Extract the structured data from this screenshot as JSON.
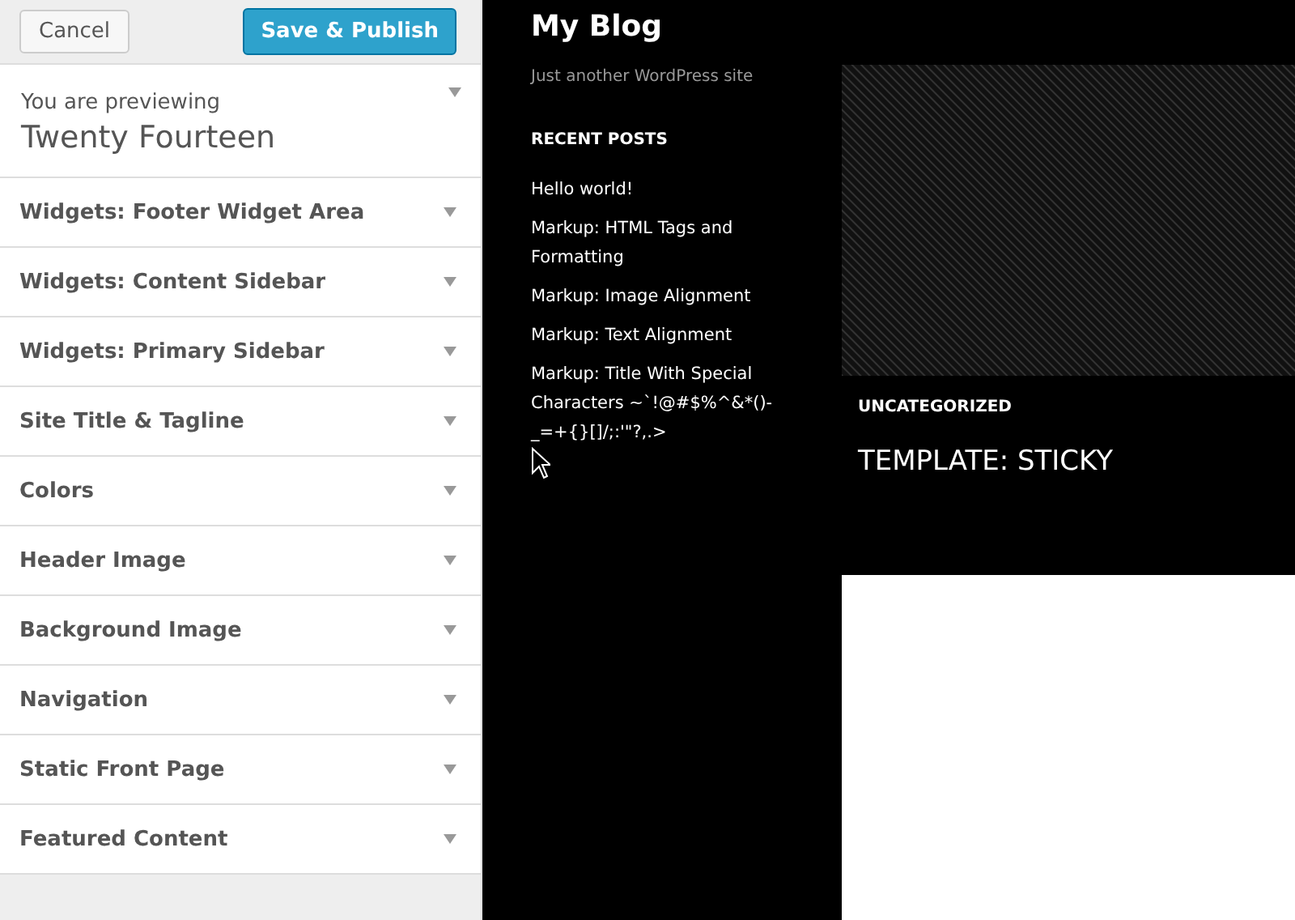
{
  "toolbar": {
    "cancel": "Cancel",
    "publish": "Save & Publish"
  },
  "theme_info": {
    "label": "You are previewing",
    "name": "Twenty Fourteen"
  },
  "sections": [
    {
      "label": "Widgets: Footer Widget Area"
    },
    {
      "label": "Widgets: Content Sidebar"
    },
    {
      "label": "Widgets: Primary Sidebar"
    },
    {
      "label": "Site Title & Tagline"
    },
    {
      "label": "Colors"
    },
    {
      "label": "Header Image"
    },
    {
      "label": "Background Image"
    },
    {
      "label": "Navigation"
    },
    {
      "label": "Static Front Page"
    },
    {
      "label": "Featured Content"
    }
  ],
  "preview": {
    "site_title": "My Blog",
    "tagline": "Just another WordPress site",
    "widget_title": "RECENT POSTS",
    "recent_posts": [
      "Hello world!",
      "Markup: HTML Tags and Formatting",
      "Markup: Image Alignment",
      "Markup: Text Alignment",
      "Markup: Title With Special Characters ~`!@#$%^&*()-_=+{}[]/;:'\"?,.>"
    ],
    "featured": {
      "category": "UNCATEGORIZED",
      "title": "TEMPLATE: STICKY"
    }
  }
}
